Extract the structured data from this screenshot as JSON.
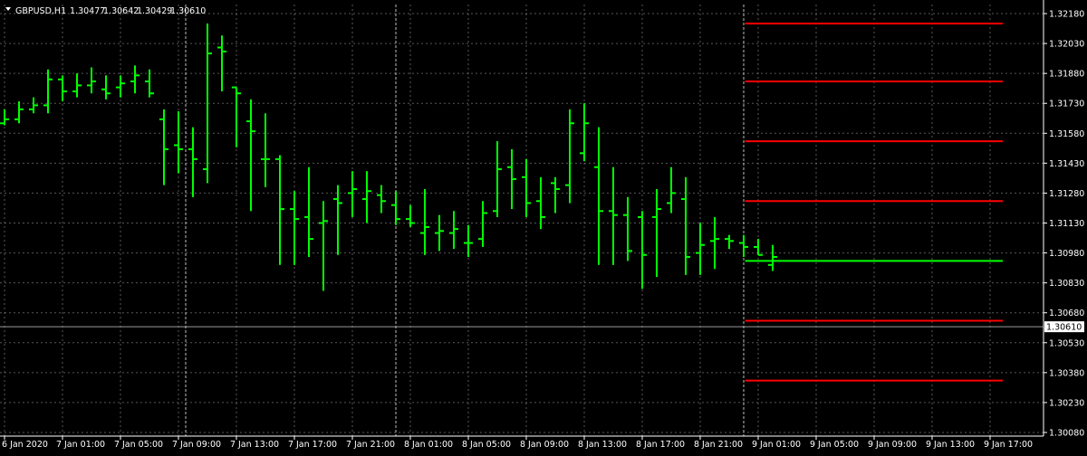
{
  "chart_data": {
    "type": "ohlc",
    "symbol_label": "GBPUSD,H1",
    "ohlc_readout": [
      "1.30477",
      "1.30642",
      "1.30429",
      "1.30610"
    ],
    "current_price": 1.3061,
    "current_price_label": "1.30610",
    "y_ticks": [
      "1.32180",
      "1.32030",
      "1.31880",
      "1.31730",
      "1.31580",
      "1.31430",
      "1.31280",
      "1.31130",
      "1.30980",
      "1.30830",
      "1.30680",
      "1.30530",
      "1.30380",
      "1.30230",
      "1.30080"
    ],
    "ylim": [
      1.3005,
      1.3223
    ],
    "x_ticks": [
      {
        "i": 0,
        "label": "6 Jan 2020"
      },
      {
        "i": 4,
        "label": "7 Jan 01:00"
      },
      {
        "i": 8,
        "label": "7 Jan 05:00"
      },
      {
        "i": 12,
        "label": "7 Jan 09:00"
      },
      {
        "i": 16,
        "label": "7 Jan 13:00"
      },
      {
        "i": 20,
        "label": "7 Jan 17:00"
      },
      {
        "i": 24,
        "label": "7 Jan 21:00"
      },
      {
        "i": 28,
        "label": "8 Jan 01:00"
      },
      {
        "i": 32,
        "label": "8 Jan 05:00"
      },
      {
        "i": 36,
        "label": "8 Jan 09:00"
      },
      {
        "i": 40,
        "label": "8 Jan 13:00"
      },
      {
        "i": 44,
        "label": "8 Jan 17:00"
      },
      {
        "i": 48,
        "label": "8 Jan 21:00"
      },
      {
        "i": 52,
        "label": "9 Jan 01:00"
      },
      {
        "i": 56,
        "label": "9 Jan 05:00"
      },
      {
        "i": 60,
        "label": "9 Jan 09:00"
      },
      {
        "i": 64,
        "label": "9 Jan 13:00"
      },
      {
        "i": 68,
        "label": "9 Jan 17:00"
      }
    ],
    "separators": [
      12.5,
      27,
      51
    ],
    "bars": [
      [
        1.3163,
        1.317,
        1.3162,
        1.3165
      ],
      [
        1.3165,
        1.3174,
        1.3163,
        1.317
      ],
      [
        1.317,
        1.3176,
        1.3168,
        1.3172
      ],
      [
        1.3172,
        1.319,
        1.3168,
        1.3185
      ],
      [
        1.3185,
        1.3187,
        1.3174,
        1.3179
      ],
      [
        1.3179,
        1.3188,
        1.3176,
        1.3182
      ],
      [
        1.3182,
        1.3191,
        1.3178,
        1.3184
      ],
      [
        1.318,
        1.3187,
        1.3175,
        1.3178
      ],
      [
        1.3181,
        1.3187,
        1.3176,
        1.3183
      ],
      [
        1.3184,
        1.3192,
        1.3178,
        1.3187
      ],
      [
        1.3184,
        1.319,
        1.3176,
        1.3178
      ],
      [
        1.3165,
        1.317,
        1.3132,
        1.315
      ],
      [
        1.3152,
        1.3169,
        1.3138,
        1.315
      ],
      [
        1.315,
        1.3161,
        1.3126,
        1.3145
      ],
      [
        1.314,
        1.3213,
        1.3133,
        1.3198
      ],
      [
        1.3201,
        1.3207,
        1.3179,
        1.3199
      ],
      [
        1.3181,
        1.3181,
        1.3151,
        1.3178
      ],
      [
        1.3164,
        1.3175,
        1.3119,
        1.3159
      ],
      [
        1.3145,
        1.3168,
        1.3131,
        1.3145
      ],
      [
        1.3145,
        1.3147,
        1.3092,
        1.312
      ],
      [
        1.312,
        1.3129,
        1.3092,
        1.3115
      ],
      [
        1.3116,
        1.3141,
        1.3096,
        1.3105
      ],
      [
        1.3113,
        1.3124,
        1.3079,
        1.3114
      ],
      [
        1.3125,
        1.3132,
        1.3097,
        1.3123
      ],
      [
        1.3128,
        1.3139,
        1.3116,
        1.313
      ],
      [
        1.3125,
        1.3139,
        1.3113,
        1.3129
      ],
      [
        1.3127,
        1.3132,
        1.3118,
        1.3124
      ],
      [
        1.3122,
        1.3129,
        1.3112,
        1.3115
      ],
      [
        1.3115,
        1.3122,
        1.3111,
        1.3113
      ],
      [
        1.3108,
        1.313,
        1.3097,
        1.3111
      ],
      [
        1.3108,
        1.3117,
        1.3099,
        1.3109
      ],
      [
        1.3108,
        1.3119,
        1.31,
        1.311
      ],
      [
        1.3103,
        1.3112,
        1.3096,
        1.3103
      ],
      [
        1.3105,
        1.3124,
        1.3101,
        1.3118
      ],
      [
        1.3119,
        1.3154,
        1.3116,
        1.314
      ],
      [
        1.3141,
        1.315,
        1.312,
        1.3135
      ],
      [
        1.3136,
        1.3145,
        1.3116,
        1.3123
      ],
      [
        1.3124,
        1.3136,
        1.311,
        1.3116
      ],
      [
        1.3133,
        1.3136,
        1.3118,
        1.313
      ],
      [
        1.3132,
        1.317,
        1.3123,
        1.3163
      ],
      [
        1.3148,
        1.3173,
        1.3144,
        1.3163
      ],
      [
        1.3141,
        1.3161,
        1.3092,
        1.3119
      ],
      [
        1.3119,
        1.3141,
        1.3092,
        1.3117
      ],
      [
        1.3117,
        1.3126,
        1.3094,
        1.3099
      ],
      [
        1.3116,
        1.3119,
        1.308,
        1.3097
      ],
      [
        1.3116,
        1.313,
        1.3086,
        1.312
      ],
      [
        1.3123,
        1.3141,
        1.3118,
        1.3128
      ],
      [
        1.3125,
        1.3136,
        1.3087,
        1.3096
      ],
      [
        1.3098,
        1.3113,
        1.3087,
        1.3102
      ],
      [
        1.3104,
        1.3116,
        1.309,
        1.3105
      ],
      [
        1.3105,
        1.3107,
        1.31,
        1.3104
      ],
      [
        1.3103,
        1.3107,
        1.3096,
        1.3101
      ],
      [
        1.3101,
        1.3105,
        1.3097,
        1.3097
      ],
      [
        1.3092,
        1.3102,
        1.3089,
        1.3096
      ]
    ],
    "overlay_lines": [
      1.3213,
      1.3184,
      1.3154,
      1.3124,
      1.3094,
      1.3064,
      1.3034
    ],
    "colors": {
      "background": "#000000",
      "grid": "#c0c0c0",
      "bars": "#00ff00",
      "levels": "#ff0000",
      "green_level": "#00ff00",
      "axis": "#ffffff",
      "text": "#ffffff",
      "price_line": "#c0c0c0"
    }
  }
}
